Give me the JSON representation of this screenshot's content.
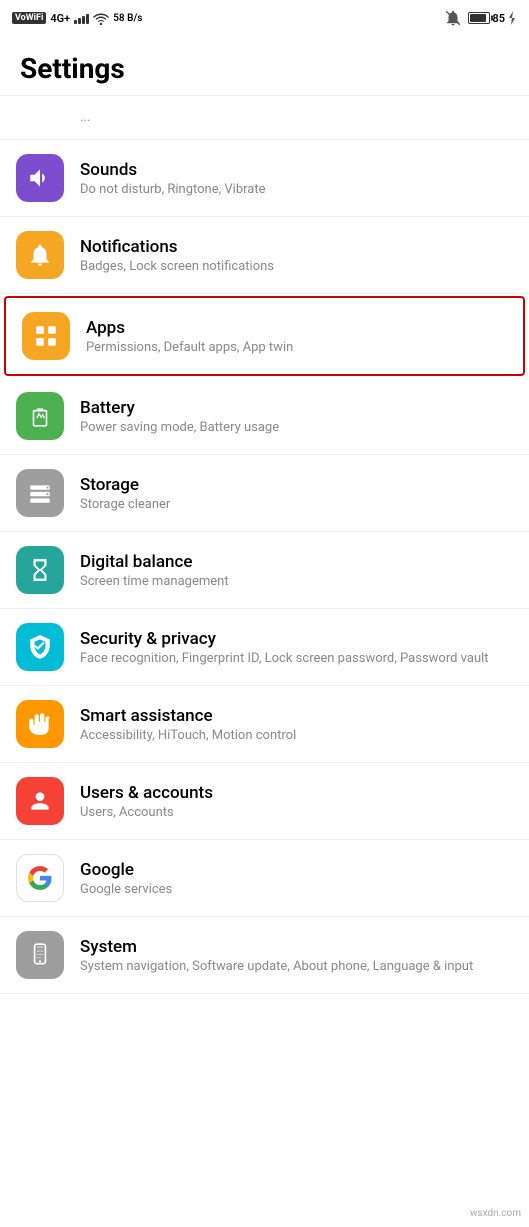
{
  "statusBar": {
    "left": {
      "vowifi": "VoWiFi",
      "network": "4G+",
      "speed": "58 B/s"
    },
    "right": {
      "battery": "85"
    }
  },
  "pageTitle": "Settings",
  "topPartialText": "...",
  "settingsItems": [
    {
      "id": "sounds",
      "title": "Sounds",
      "subtitle": "Do not disturb, Ringtone, Vibrate",
      "iconColor": "purple",
      "iconType": "speaker"
    },
    {
      "id": "notifications",
      "title": "Notifications",
      "subtitle": "Badges, Lock screen notifications",
      "iconColor": "orange",
      "iconType": "bell"
    },
    {
      "id": "apps",
      "title": "Apps",
      "subtitle": "Permissions, Default apps, App twin",
      "iconColor": "orange-apps",
      "iconType": "apps",
      "highlighted": true
    },
    {
      "id": "battery",
      "title": "Battery",
      "subtitle": "Power saving mode, Battery usage",
      "iconColor": "green",
      "iconType": "battery"
    },
    {
      "id": "storage",
      "title": "Storage",
      "subtitle": "Storage cleaner",
      "iconColor": "gray",
      "iconType": "storage"
    },
    {
      "id": "digital-balance",
      "title": "Digital balance",
      "subtitle": "Screen time management",
      "iconColor": "teal-dark",
      "iconType": "hourglass"
    },
    {
      "id": "security-privacy",
      "title": "Security & privacy",
      "subtitle": "Face recognition, Fingerprint ID, Lock screen password, Password vault",
      "iconColor": "teal",
      "iconType": "shield"
    },
    {
      "id": "smart-assistance",
      "title": "Smart assistance",
      "subtitle": "Accessibility, HiTouch, Motion control",
      "iconColor": "orange-hand",
      "iconType": "hand"
    },
    {
      "id": "users-accounts",
      "title": "Users & accounts",
      "subtitle": "Users, Accounts",
      "iconColor": "red",
      "iconType": "user"
    },
    {
      "id": "google",
      "title": "Google",
      "subtitle": "Google services",
      "iconColor": "white-google",
      "iconType": "google"
    },
    {
      "id": "system",
      "title": "System",
      "subtitle": "System navigation, Software update, About phone, Language & input",
      "iconColor": "gray-system",
      "iconType": "phone"
    }
  ],
  "watermark": "wsxdn.com"
}
